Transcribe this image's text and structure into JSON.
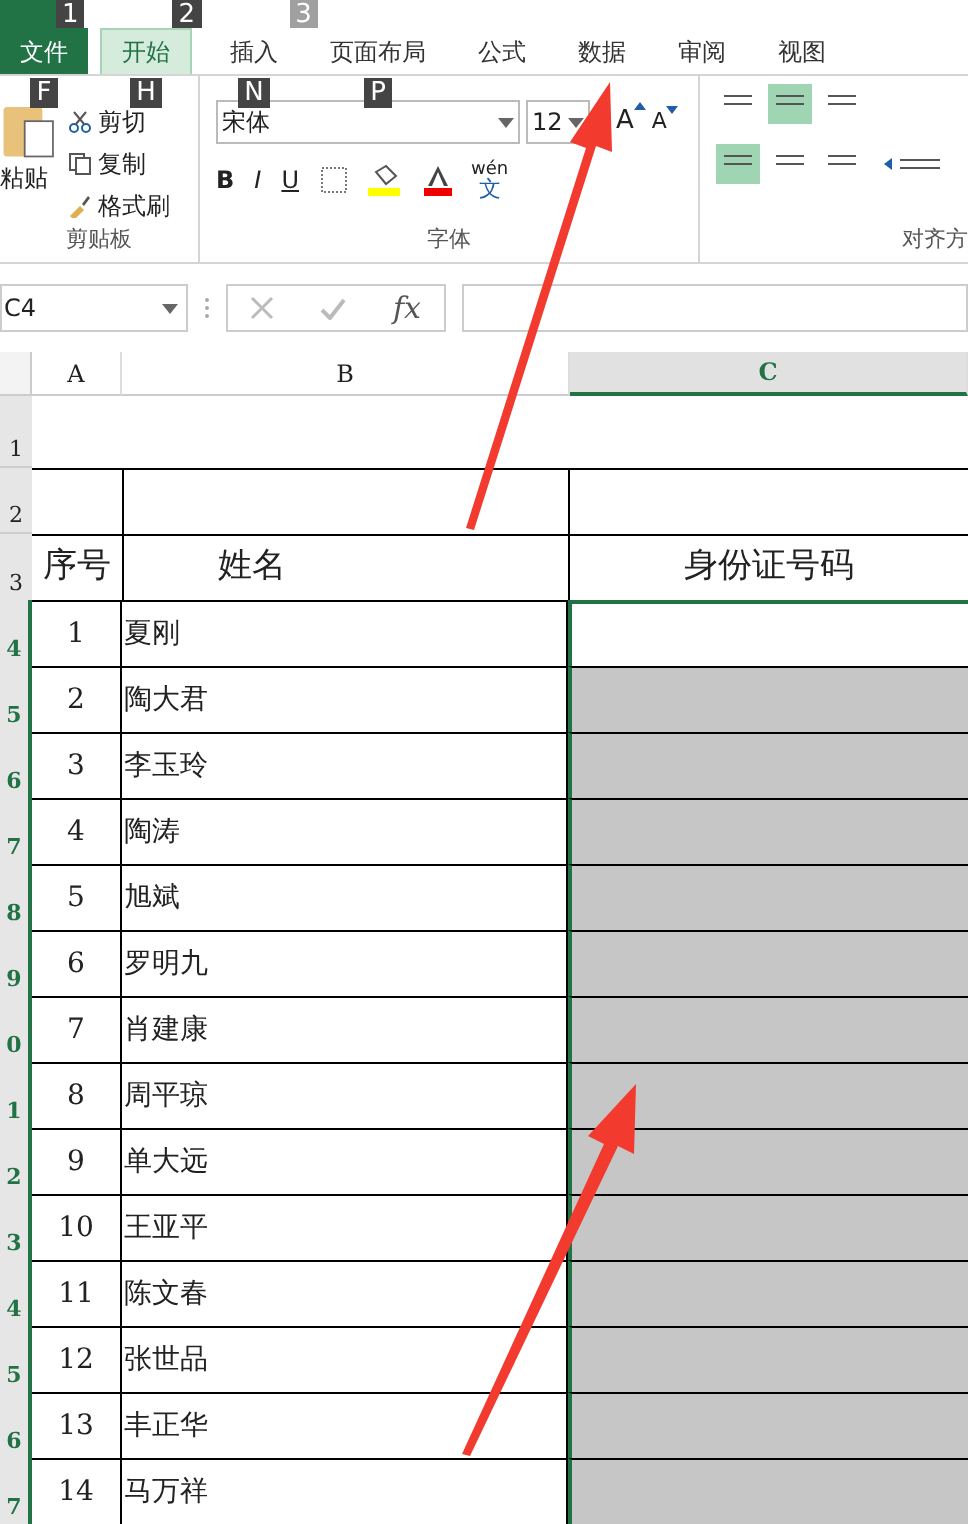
{
  "key_tips_top": [
    {
      "label": "1",
      "disabled": false
    },
    {
      "label": "2",
      "disabled": false
    },
    {
      "label": "3",
      "disabled": true
    }
  ],
  "tabs": [
    {
      "label": "文件",
      "kind": "file",
      "selected": false,
      "key_tip": "F"
    },
    {
      "label": "开始",
      "kind": "tab",
      "selected": true,
      "key_tip": "H"
    },
    {
      "label": "插入",
      "kind": "tab",
      "selected": false,
      "key_tip": "N"
    },
    {
      "label": "页面布局",
      "kind": "tab",
      "selected": false,
      "key_tip": "P"
    },
    {
      "label": "公式",
      "kind": "tab",
      "selected": false
    },
    {
      "label": "数据",
      "kind": "tab",
      "selected": false
    },
    {
      "label": "审阅",
      "kind": "tab",
      "selected": false
    },
    {
      "label": "视图",
      "kind": "tab",
      "selected": false
    }
  ],
  "clipboard": {
    "paste": "粘贴",
    "cut": "剪切",
    "copy": "复制",
    "format_painter": "格式刷",
    "group_label": "剪贴板"
  },
  "font": {
    "name": "宋体",
    "size": "12",
    "grow": "A",
    "shrink": "A",
    "bold": "B",
    "italic": "I",
    "underline": "U",
    "phonetic": "wén",
    "phonetic_char": "文",
    "group_label": "字体"
  },
  "alignment": {
    "group_label": "对齐方"
  },
  "name_box": "C4",
  "function_label": "fx",
  "columns": [
    {
      "label": "A",
      "selected": false
    },
    {
      "label": "B",
      "selected": false
    },
    {
      "label": "C",
      "selected": true
    }
  ],
  "header_rows": [
    {
      "row": "1"
    },
    {
      "row": "2"
    }
  ],
  "title_row": {
    "row": "3",
    "seq": "序号",
    "name": "姓名",
    "id": "身份证号码"
  },
  "rows": [
    {
      "row": "4",
      "seq": "1",
      "name": "夏刚",
      "selected": true,
      "active": true
    },
    {
      "row": "5",
      "seq": "2",
      "name": "陶大君",
      "selected": true,
      "active": false
    },
    {
      "row": "6",
      "seq": "3",
      "name": "李玉玲",
      "selected": true,
      "active": false
    },
    {
      "row": "7",
      "seq": "4",
      "name": "陶涛",
      "selected": true,
      "active": false
    },
    {
      "row": "8",
      "seq": "5",
      "name": "旭斌",
      "selected": true,
      "active": false
    },
    {
      "row": "9",
      "seq": "6",
      "name": "罗明九",
      "selected": true,
      "active": false
    },
    {
      "row": "0",
      "seq": "7",
      "name": "肖建康",
      "selected": true,
      "active": false
    },
    {
      "row": "1",
      "seq": "8",
      "name": "周平琼",
      "selected": true,
      "active": false
    },
    {
      "row": "2",
      "seq": "9",
      "name": "单大远",
      "selected": true,
      "active": false
    },
    {
      "row": "3",
      "seq": "10",
      "name": "王亚平",
      "selected": true,
      "active": false
    },
    {
      "row": "4",
      "seq": "11",
      "name": "陈文春",
      "selected": true,
      "active": false
    },
    {
      "row": "5",
      "seq": "12",
      "name": "张世品",
      "selected": true,
      "active": false
    },
    {
      "row": "6",
      "seq": "13",
      "name": "丰正华",
      "selected": true,
      "active": false
    },
    {
      "row": "7",
      "seq": "14",
      "name": "马万祥",
      "selected": true,
      "active": false
    }
  ]
}
